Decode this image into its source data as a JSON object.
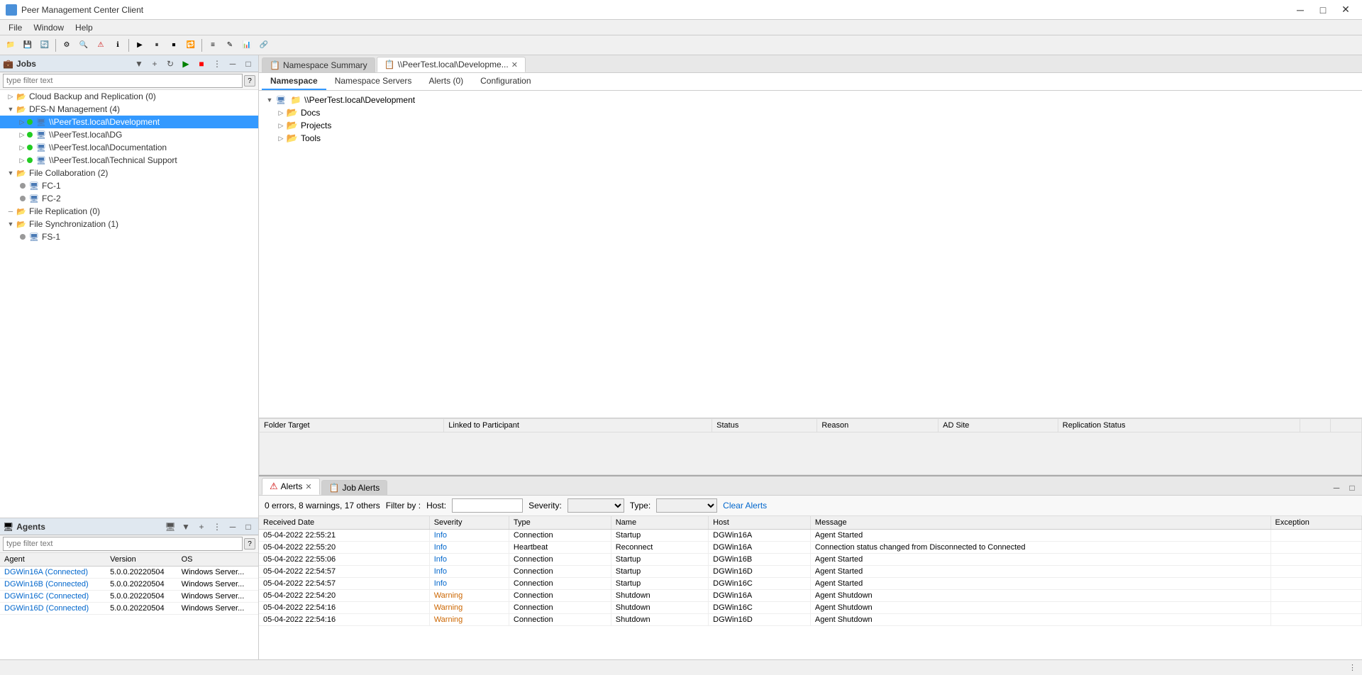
{
  "titleBar": {
    "title": "Peer Management Center Client",
    "minimizeLabel": "─",
    "maximizeLabel": "□",
    "closeLabel": "✕"
  },
  "menuBar": {
    "items": [
      "File",
      "Window",
      "Help"
    ]
  },
  "leftPanel": {
    "jobs": {
      "title": "Jobs",
      "filterPlaceholder": "type filter text",
      "helpLabel": "?",
      "tree": [
        {
          "id": "cloud-backup",
          "indent": 0,
          "expanded": false,
          "label": "Cloud Backup and Replication (0)",
          "iconType": "group"
        },
        {
          "id": "dfsn-mgmt",
          "indent": 0,
          "expanded": true,
          "label": "DFS-N Management (4)",
          "iconType": "group"
        },
        {
          "id": "development",
          "indent": 1,
          "expanded": false,
          "label": "\\\\PeerTest.local\\Development",
          "iconType": "dfsn",
          "status": "green",
          "selected": true
        },
        {
          "id": "dg",
          "indent": 1,
          "expanded": false,
          "label": "\\\\PeerTest.local\\DG",
          "iconType": "dfsn",
          "status": "green"
        },
        {
          "id": "documentation",
          "indent": 1,
          "expanded": false,
          "label": "\\\\PeerTest.local\\Documentation",
          "iconType": "dfsn",
          "status": "green"
        },
        {
          "id": "techsupport",
          "indent": 1,
          "expanded": false,
          "label": "\\\\PeerTest.local\\Technical Support",
          "iconType": "dfsn",
          "status": "green"
        },
        {
          "id": "file-collab",
          "indent": 0,
          "expanded": true,
          "label": "File Collaboration (2)",
          "iconType": "group"
        },
        {
          "id": "fc1",
          "indent": 1,
          "expanded": false,
          "label": "FC-1",
          "iconType": "job",
          "status": "gray"
        },
        {
          "id": "fc2",
          "indent": 1,
          "expanded": false,
          "label": "FC-2",
          "iconType": "job",
          "status": "gray"
        },
        {
          "id": "file-repl",
          "indent": 0,
          "expanded": false,
          "label": "File Replication (0)",
          "iconType": "group"
        },
        {
          "id": "file-sync",
          "indent": 0,
          "expanded": true,
          "label": "File Synchronization (1)",
          "iconType": "group"
        },
        {
          "id": "fs1",
          "indent": 1,
          "expanded": false,
          "label": "FS-1",
          "iconType": "job",
          "status": "gray"
        }
      ]
    },
    "agents": {
      "title": "Agents",
      "filterPlaceholder": "type filter text",
      "helpLabel": "?",
      "columns": [
        "Agent",
        "Version",
        "OS"
      ],
      "rows": [
        {
          "agent": "DGWin16A (Connected)",
          "version": "5.0.0.20220504",
          "os": "Windows Server..."
        },
        {
          "agent": "DGWin16B (Connected)",
          "version": "5.0.0.20220504",
          "os": "Windows Server..."
        },
        {
          "agent": "DGWin16C (Connected)",
          "version": "5.0.0.20220504",
          "os": "Windows Server..."
        },
        {
          "agent": "DGWin16D (Connected)",
          "version": "5.0.0.20220504",
          "os": "Windows Server..."
        }
      ]
    }
  },
  "rightPanel": {
    "tabs": [
      {
        "id": "namespace-summary",
        "label": "Namespace Summary",
        "closeable": false,
        "active": false
      },
      {
        "id": "development-tab",
        "label": "\\\\PeerTest.local\\Developme...",
        "closeable": true,
        "active": true
      }
    ],
    "contentTabs": [
      {
        "id": "namespace",
        "label": "Namespace",
        "active": true
      },
      {
        "id": "ns-servers",
        "label": "Namespace Servers",
        "active": false
      },
      {
        "id": "alerts",
        "label": "Alerts (0)",
        "active": false
      },
      {
        "id": "configuration",
        "label": "Configuration",
        "active": false
      }
    ],
    "namespaceTree": {
      "root": {
        "label": "\\\\PeerTest.local\\Development",
        "expanded": true,
        "children": [
          {
            "label": "Docs",
            "type": "folder",
            "expanded": false
          },
          {
            "label": "Projects",
            "type": "folder",
            "expanded": false
          },
          {
            "label": "Tools",
            "type": "folder",
            "expanded": false
          }
        ]
      }
    },
    "folderTable": {
      "columns": [
        "Folder Target",
        "Linked to Participant",
        "Status",
        "Reason",
        "AD Site",
        "Replication Status"
      ]
    }
  },
  "bottomPanel": {
    "tabs": [
      {
        "id": "alerts",
        "label": "Alerts",
        "active": true,
        "closeable": true
      },
      {
        "id": "job-alerts",
        "label": "Job Alerts",
        "active": false,
        "closeable": false
      }
    ],
    "alertsSummary": "0 errors, 8 warnings, 17 others",
    "filterBy": "Filter by :",
    "hostLabel": "Host:",
    "severityLabel": "Severity:",
    "typeLabel": "Type:",
    "clearAlertsLabel": "Clear Alerts",
    "columns": [
      "Received Date",
      "Severity",
      "Type",
      "Name",
      "Host",
      "Message",
      "Exception"
    ],
    "rows": [
      {
        "date": "05-04-2022 22:55:21",
        "severity": "Info",
        "type": "Connection",
        "name": "Startup",
        "host": "DGWin16A",
        "message": "Agent Started",
        "exception": ""
      },
      {
        "date": "05-04-2022 22:55:20",
        "severity": "Info",
        "type": "Heartbeat",
        "name": "Reconnect",
        "host": "DGWin16A",
        "message": "Connection status changed from Disconnected to Connected",
        "exception": ""
      },
      {
        "date": "05-04-2022 22:55:06",
        "severity": "Info",
        "type": "Connection",
        "name": "Startup",
        "host": "DGWin16B",
        "message": "Agent Started",
        "exception": ""
      },
      {
        "date": "05-04-2022 22:54:57",
        "severity": "Info",
        "type": "Connection",
        "name": "Startup",
        "host": "DGWin16D",
        "message": "Agent Started",
        "exception": ""
      },
      {
        "date": "05-04-2022 22:54:57",
        "severity": "Info",
        "type": "Connection",
        "name": "Startup",
        "host": "DGWin16C",
        "message": "Agent Started",
        "exception": ""
      },
      {
        "date": "05-04-2022 22:54:20",
        "severity": "Warning",
        "type": "Connection",
        "name": "Shutdown",
        "host": "DGWin16A",
        "message": "Agent Shutdown",
        "exception": ""
      },
      {
        "date": "05-04-2022 22:54:16",
        "severity": "Warning",
        "type": "Connection",
        "name": "Shutdown",
        "host": "DGWin16C",
        "message": "Agent Shutdown",
        "exception": ""
      },
      {
        "date": "05-04-2022 22:54:16",
        "severity": "Warning",
        "type": "Connection",
        "name": "Shutdown",
        "host": "DGWin16D",
        "message": "Agent Shutdown",
        "exception": ""
      }
    ]
  }
}
